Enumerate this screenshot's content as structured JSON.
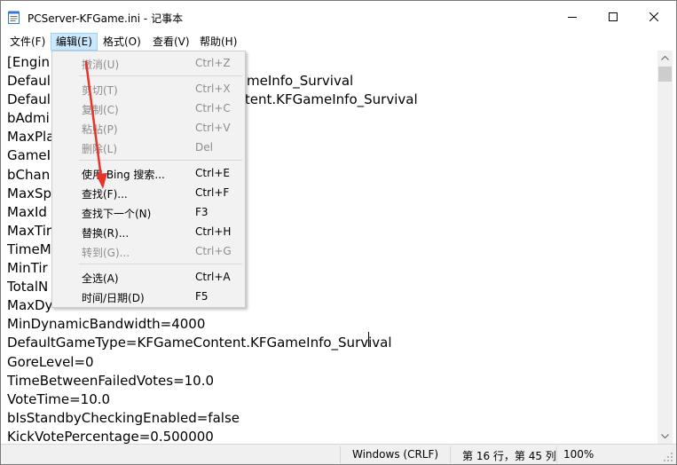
{
  "window": {
    "title": "PCServer-KFGame.ini - 记事本",
    "controls": {
      "minimize": "minimize-icon",
      "maximize": "maximize-icon",
      "close": "close-icon"
    }
  },
  "menubar": {
    "items": [
      {
        "label": "文件(F)"
      },
      {
        "label": "编辑(E)"
      },
      {
        "label": "格式(O)"
      },
      {
        "label": "查看(V)"
      },
      {
        "label": "帮助(H)"
      }
    ]
  },
  "edit_menu": {
    "items": [
      {
        "label": "撤消(U)",
        "shortcut": "Ctrl+Z",
        "enabled": false
      },
      {
        "label": "剪切(T)",
        "shortcut": "Ctrl+X",
        "enabled": false
      },
      {
        "label": "复制(C)",
        "shortcut": "Ctrl+C",
        "enabled": false
      },
      {
        "label": "粘贴(P)",
        "shortcut": "Ctrl+V",
        "enabled": false
      },
      {
        "label": "删除(L)",
        "shortcut": "Del",
        "enabled": false
      },
      {
        "label": "使用 Bing 搜索...",
        "shortcut": "Ctrl+E",
        "enabled": true
      },
      {
        "label": "查找(F)...",
        "shortcut": "Ctrl+F",
        "enabled": true
      },
      {
        "label": "查找下一个(N)",
        "shortcut": "F3",
        "enabled": true
      },
      {
        "label": "替换(R)...",
        "shortcut": "Ctrl+H",
        "enabled": true
      },
      {
        "label": "转到(G)...",
        "shortcut": "Ctrl+G",
        "enabled": false
      },
      {
        "label": "全选(A)",
        "shortcut": "Ctrl+A",
        "enabled": true
      },
      {
        "label": "时间/日期(D)",
        "shortcut": "F5",
        "enabled": true
      }
    ]
  },
  "editor": {
    "lines": [
      "[Engin",
      "Defaul                                          GameInfo_Survival",
      "Defaul                                          ontent.KFGameInfo_Survival",
      "bAdmi",
      "MaxPla",
      "GameI",
      "bChan",
      "MaxSp",
      "MaxId",
      "MaxTir",
      "TimeM",
      "MinTir",
      "TotalN",
      "MaxDy",
      "MinDynamicBandwidth=4000",
      "DefaultGameType=KFGameContent.KFGameInfo_Survival",
      "GoreLevel=0",
      "TimeBetweenFailedVotes=10.0",
      "VoteTime=10.0",
      "bIsStandbyCheckingEnabled=false",
      "KickVotePercentage=0.500000"
    ]
  },
  "statusbar": {
    "line_ending": "Windows (CRLF)",
    "position": "第 16 行，第 45 列",
    "zoom": "100%"
  },
  "colors": {
    "menu_active_bg": "#cce8ff",
    "dropdown_bg": "#f2f2f2",
    "disabled_text": "#8d8d8d",
    "annotation_arrow": "#e8332a"
  }
}
